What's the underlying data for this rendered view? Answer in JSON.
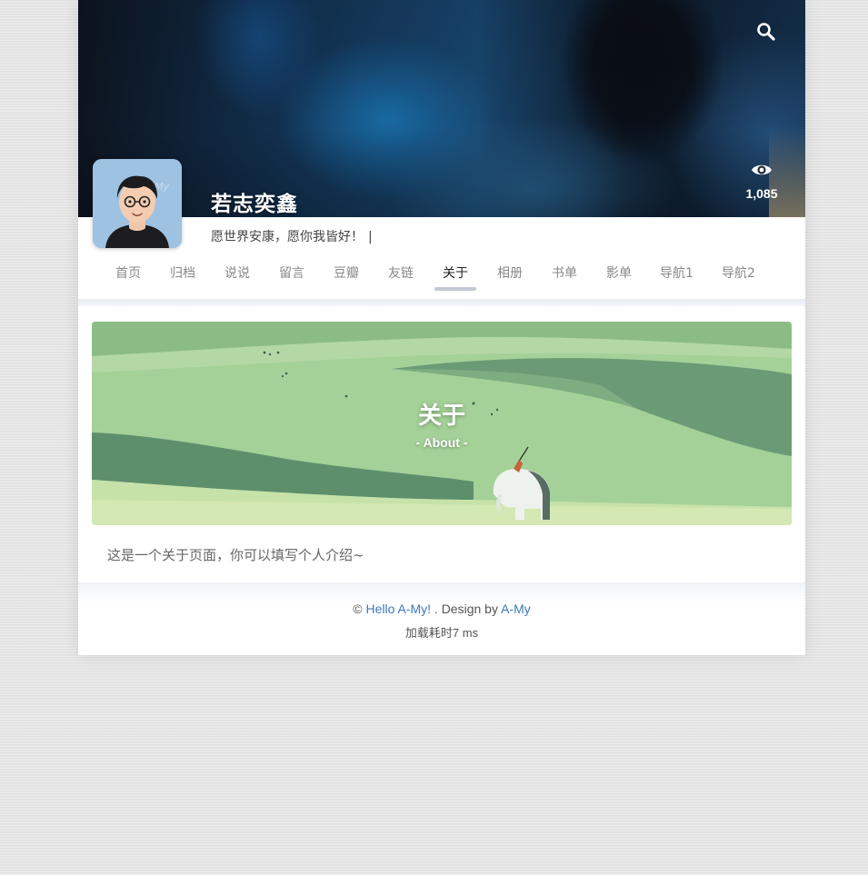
{
  "header": {
    "site_title": "若志奕鑫",
    "subtitle": "愿世界安康，愿你我皆好！",
    "cursor": "|",
    "search_icon": "search-icon",
    "views_icon": "eye-icon",
    "views_count": "1,085"
  },
  "nav": {
    "items": [
      {
        "label": "首页"
      },
      {
        "label": "归档"
      },
      {
        "label": "说说"
      },
      {
        "label": "留言"
      },
      {
        "label": "豆瓣"
      },
      {
        "label": "友链"
      },
      {
        "label": "关于"
      },
      {
        "label": "相册"
      },
      {
        "label": "书单"
      },
      {
        "label": "影单"
      },
      {
        "label": "导航1"
      },
      {
        "label": "导航2"
      }
    ],
    "active": "关于"
  },
  "banner": {
    "title": "关于",
    "subtitle": "- About -"
  },
  "content": {
    "intro": "这是一个关于页面，你可以填写个人介绍~"
  },
  "footer": {
    "copyright_symbol": "©",
    "site_link": "Hello A-My!",
    "separator": ". Design by",
    "theme_link": "A-My",
    "load_time": "加载耗时7 ms"
  },
  "colors": {
    "link": "#3b78b6",
    "active_underline": "#c3c9d2",
    "banner_green": "#a9d39c"
  }
}
